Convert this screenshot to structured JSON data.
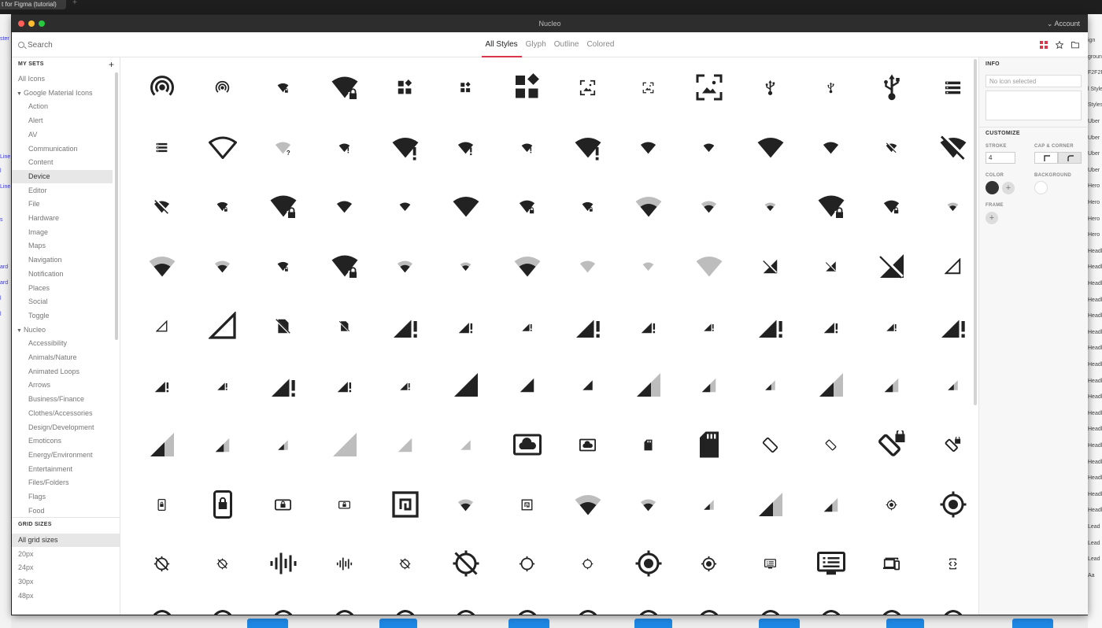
{
  "colors": {
    "accent": "#d8384a",
    "icon": "#222222",
    "icon_muted": "#bdbdbd"
  },
  "background_app": {
    "tab_title": "t for Figma (tutorial)",
    "left_edge_texts": [
      "ster",
      "Line",
      "l",
      "Line",
      "s",
      "ard",
      "ard",
      "l",
      "l"
    ],
    "right_edge_texts": [
      "ign",
      "ground",
      "F2F2F",
      "l Style",
      "Styles",
      "Uber",
      "Uber",
      "Uber",
      "Uber",
      "Hero",
      "Hero",
      "Hero",
      "Hero",
      "Headl",
      "Headl",
      "Headl",
      "Headl",
      "Headl",
      "Headl",
      "Headl",
      "Headl",
      "Headl",
      "Headl",
      "Headl",
      "Headl",
      "Headl",
      "Headl",
      "Headl",
      "Headl",
      "Headl",
      "Lead",
      "Lead",
      "Lead",
      "Aa"
    ]
  },
  "window": {
    "title": "Nucleo",
    "account_label": "Account"
  },
  "search": {
    "placeholder": "Search"
  },
  "style_tabs": [
    {
      "label": "All Styles",
      "active": true
    },
    {
      "label": "Glyph",
      "active": false
    },
    {
      "label": "Outline",
      "active": false
    },
    {
      "label": "Colored",
      "active": false
    }
  ],
  "toolbar_icons": [
    "grid-view-icon",
    "star-icon",
    "folder-icon"
  ],
  "sidebar": {
    "heading": "MY SETS",
    "add_label": "+",
    "items": [
      {
        "label": "All Icons",
        "level": 0,
        "caret": false,
        "selected": false
      },
      {
        "label": "Google Material Icons",
        "level": 0,
        "caret": true,
        "selected": false
      },
      {
        "label": "Action",
        "level": 1,
        "caret": false,
        "selected": false
      },
      {
        "label": "Alert",
        "level": 1,
        "caret": false,
        "selected": false
      },
      {
        "label": "AV",
        "level": 1,
        "caret": false,
        "selected": false
      },
      {
        "label": "Communication",
        "level": 1,
        "caret": false,
        "selected": false
      },
      {
        "label": "Content",
        "level": 1,
        "caret": false,
        "selected": false
      },
      {
        "label": "Device",
        "level": 1,
        "caret": false,
        "selected": true
      },
      {
        "label": "Editor",
        "level": 1,
        "caret": false,
        "selected": false
      },
      {
        "label": "File",
        "level": 1,
        "caret": false,
        "selected": false
      },
      {
        "label": "Hardware",
        "level": 1,
        "caret": false,
        "selected": false
      },
      {
        "label": "Image",
        "level": 1,
        "caret": false,
        "selected": false
      },
      {
        "label": "Maps",
        "level": 1,
        "caret": false,
        "selected": false
      },
      {
        "label": "Navigation",
        "level": 1,
        "caret": false,
        "selected": false
      },
      {
        "label": "Notification",
        "level": 1,
        "caret": false,
        "selected": false
      },
      {
        "label": "Places",
        "level": 1,
        "caret": false,
        "selected": false
      },
      {
        "label": "Social",
        "level": 1,
        "caret": false,
        "selected": false
      },
      {
        "label": "Toggle",
        "level": 1,
        "caret": false,
        "selected": false
      },
      {
        "label": "Nucleo",
        "level": 0,
        "caret": true,
        "selected": false
      },
      {
        "label": "Accessibility",
        "level": 1,
        "caret": false,
        "selected": false
      },
      {
        "label": "Animals/Nature",
        "level": 1,
        "caret": false,
        "selected": false
      },
      {
        "label": "Animated Loops",
        "level": 1,
        "caret": false,
        "selected": false
      },
      {
        "label": "Arrows",
        "level": 1,
        "caret": false,
        "selected": false
      },
      {
        "label": "Business/Finance",
        "level": 1,
        "caret": false,
        "selected": false
      },
      {
        "label": "Clothes/Accessories",
        "level": 1,
        "caret": false,
        "selected": false
      },
      {
        "label": "Design/Development",
        "level": 1,
        "caret": false,
        "selected": false
      },
      {
        "label": "Emoticons",
        "level": 1,
        "caret": false,
        "selected": false
      },
      {
        "label": "Energy/Environment",
        "level": 1,
        "caret": false,
        "selected": false
      },
      {
        "label": "Entertainment",
        "level": 1,
        "caret": false,
        "selected": false
      },
      {
        "label": "Files/Folders",
        "level": 1,
        "caret": false,
        "selected": false
      },
      {
        "label": "Flags",
        "level": 1,
        "caret": false,
        "selected": false
      },
      {
        "label": "Food",
        "level": 1,
        "caret": false,
        "selected": false
      }
    ]
  },
  "grid_sizes": {
    "heading": "GRID SIZES",
    "items": [
      {
        "label": "All grid sizes",
        "selected": true
      },
      {
        "label": "20px",
        "selected": false
      },
      {
        "label": "24px",
        "selected": false
      },
      {
        "label": "30px",
        "selected": false
      },
      {
        "label": "48px",
        "selected": false
      }
    ]
  },
  "icon_grid": [
    [
      "hotspot-icon",
      "hotspot-icon",
      "wifi-lock-icon",
      "wifi-lock-icon",
      "widgets-icon",
      "widgets-icon",
      "widgets-icon",
      "wallpaper-icon",
      "wallpaper-icon",
      "wallpaper-icon",
      "usb-icon",
      "usb-icon",
      "usb-icon",
      "storage-icon"
    ],
    [
      "storage-icon",
      "wifi-outline-icon",
      "wifi-unknown-icon",
      "wifi-alert-icon",
      "wifi-alert-icon",
      "wifi-alert-icon",
      "wifi-alert-icon",
      "wifi-alert-icon",
      "wifi-full-icon",
      "wifi-full-icon",
      "wifi-full-icon",
      "wifi-full-icon",
      "wifi-off-icon",
      "wifi-off-icon"
    ],
    [
      "wifi-off-icon",
      "wifi-lock-icon",
      "wifi-lock-icon",
      "wifi-full-icon",
      "wifi-full-icon",
      "wifi-full-icon",
      "wifi-lock-icon",
      "wifi-lock-icon",
      "wifi-strength-icon",
      "wifi-strength-icon",
      "wifi-strength-icon",
      "wifi-lock-icon",
      "wifi-lock-icon",
      "wifi-strength-icon"
    ],
    [
      "wifi-strength-icon",
      "wifi-strength-icon",
      "wifi-lock-icon",
      "wifi-lock-icon",
      "wifi-strength-icon",
      "wifi-strength-icon",
      "wifi-strength-icon",
      "wifi-empty-icon",
      "wifi-empty-icon",
      "wifi-empty-icon",
      "signal-off-icon",
      "signal-off-icon",
      "signal-off-icon",
      "signal-null-icon"
    ],
    [
      "signal-null-icon",
      "signal-null-icon",
      "sim-off-icon",
      "sim-off-icon",
      "signal-alert-icon",
      "signal-alert-icon",
      "signal-alert-icon",
      "signal-alert-icon",
      "signal-alert-icon",
      "signal-alert-icon",
      "signal-alert-icon",
      "signal-alert-icon",
      "signal-alert-icon",
      "signal-alert-icon"
    ],
    [
      "signal-alert-icon",
      "signal-alert-icon",
      "signal-alert-icon",
      "signal-alert-icon",
      "signal-alert-icon",
      "signal-full-icon",
      "signal-full-icon",
      "signal-full-icon",
      "signal-level-icon",
      "signal-level-icon",
      "signal-level-icon",
      "signal-level-icon",
      "signal-level-icon",
      "signal-level-icon"
    ],
    [
      "signal-level-icon",
      "signal-level-icon",
      "signal-level-icon",
      "signal-empty-icon",
      "signal-empty-icon",
      "signal-empty-icon",
      "cloud-screen-icon",
      "cloud-screen-icon",
      "sd-card-icon",
      "sd-card-icon",
      "screen-rotation-icon",
      "screen-rotation-icon",
      "rotation-lock-icon",
      "rotation-lock-icon"
    ],
    [
      "portrait-lock-icon",
      "portrait-lock-icon",
      "landscape-lock-icon",
      "landscape-lock-icon",
      "nfc-icon",
      "wifi-strength-icon",
      "nfc-icon",
      "wifi-strength-icon",
      "wifi-strength-icon",
      "signal-level-icon",
      "signal-level-icon",
      "signal-level-icon",
      "gps-fixed-icon",
      "gps-fixed-icon"
    ],
    [
      "gps-off-icon",
      "gps-off-icon",
      "graphic-eq-icon",
      "graphic-eq-icon",
      "gps-off-icon",
      "gps-off-icon",
      "gps-not-fixed-icon",
      "gps-not-fixed-icon",
      "gps-fixed-icon",
      "gps-fixed-icon",
      "dvr-icon",
      "dvr-icon",
      "devices-icon",
      "developer-mode-icon"
    ],
    [
      "icon-partial",
      "icon-partial",
      "icon-partial",
      "icon-partial",
      "icon-partial",
      "icon-partial",
      "icon-partial",
      "icon-partial",
      "icon-partial",
      "icon-partial",
      "icon-partial",
      "icon-partial",
      "icon-partial",
      "icon-partial"
    ]
  ],
  "panel": {
    "info_heading": "INFO",
    "no_icon_text": "No icon selected",
    "customize_heading": "CUSTOMIZE",
    "stroke_label": "STROKE",
    "stroke_value": "4",
    "cap_label": "CAP & CORNER",
    "color_label": "COLOR",
    "background_label": "BACKGROUND",
    "frame_label": "FRAME",
    "color_value": "#333333",
    "background_value": "#ffffff"
  }
}
